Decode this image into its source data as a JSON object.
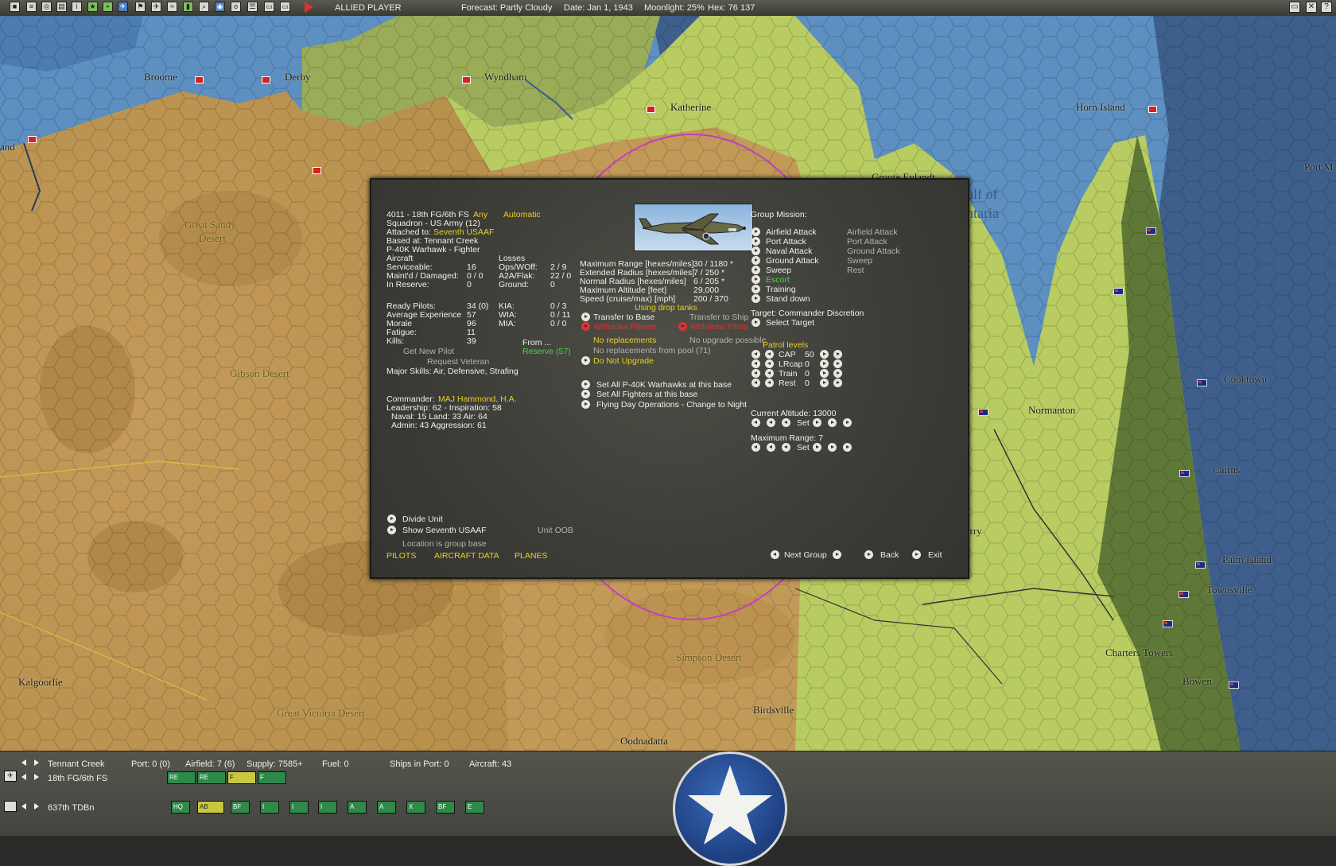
{
  "topbar": {
    "player": "ALLIED PLAYER",
    "forecast": "Forecast: Partly Cloudy",
    "date": "Date: Jan 1, 1943",
    "moonlight": "Moonlight: 25%",
    "hex": "Hex: 76 137",
    "toolbar_icons": [
      "save-icon",
      "report-icon",
      "intel-icon",
      "ships-icon",
      "info-icon",
      "star-icon",
      "bases-icon",
      "air-icon",
      "flag-icon",
      "planes-icon",
      "routes-icon",
      "units-icon",
      "search-icon",
      "globe-icon",
      "ob-icon",
      "list-icon",
      "screen-icon",
      "end-turn-icon"
    ]
  },
  "map": {
    "labels": {
      "broome": "Broome",
      "derby": "Derby",
      "wyndham": "Wyndham",
      "katherine": "Katherine",
      "horn_island": "Horn Island",
      "torres_strait": "Torres Strait",
      "port_m": "Port M",
      "groote": "Groote Eylandt",
      "gulf": "ulf of",
      "carpentaria": "ntaria",
      "great_sandy": "Great Sandy",
      "desert": "Desert",
      "gibson": "Gibson Desert",
      "normanton": "Normanton",
      "cooktown": "Cooktown",
      "cairns": "Cairns",
      "urry": "urry",
      "palm_island": "Palm Island",
      "townsville": "Townsville",
      "charters_towers": "Charters Towers",
      "bowen": "Bowen",
      "simpson": "Simpson Desert",
      "birdsville": "Birdsville",
      "great_victoria": "Great Victoria Desert",
      "kalgoorlie": "Kalgoorlie",
      "oodnadatta": "Oodnadatta",
      "land": "and"
    }
  },
  "dialog": {
    "unit_id": "4011 - 18th FG/6th FS",
    "any": "Any",
    "automatic": "Automatic",
    "squadron": "Squadron - US Army (12)",
    "attached_label": "Attached to:",
    "attached_value": "Seventh USAAF",
    "based_at": "Based at: Tennant Creek",
    "aircraft_type": "P-40K Warhawk - Fighter",
    "aircraft_header": "Aircraft",
    "losses_header": "Losses",
    "stats_left": [
      {
        "label": "Serviceable:",
        "value": "16"
      },
      {
        "label": "Maint'd / Damaged:",
        "value": "0 / 0"
      },
      {
        "label": "In Reserve:",
        "value": "0"
      }
    ],
    "stats_losses": [
      {
        "label": "Ops/WOff:",
        "value": "2 / 9"
      },
      {
        "label": "A2A/Flak:",
        "value": "22 / 0"
      },
      {
        "label": "Ground:",
        "value": "0"
      }
    ],
    "pilot_stats": [
      {
        "label": "Ready Pilots:",
        "value": "34 (0)"
      },
      {
        "label": "Average Experience",
        "value": "57"
      },
      {
        "label": "Morale",
        "value": "96"
      },
      {
        "label": "Fatigue:",
        "value": "11"
      },
      {
        "label": "Kills:",
        "value": "39"
      }
    ],
    "casualties": [
      {
        "label": "KIA:",
        "value": "0 / 3"
      },
      {
        "label": "WIA:",
        "value": "0 / 11"
      },
      {
        "label": "MIA:",
        "value": "0 / 0"
      }
    ],
    "get_new_pilot": "Get New Pilot",
    "request_veteran": "Request Veteran",
    "from": "From ...",
    "reserve": "Reserve (57)",
    "major_skills": "Major Skills: Air, Defensive, Strafing",
    "commander_label": "Commander:",
    "commander_value": "MAJ Hammond, H.A.",
    "leadership": "Leadership: 62 - Inspiration: 58",
    "naval_land_air": "Naval: 15  Land: 33  Air: 64",
    "admin_aggression": "Admin: 43  Aggression: 61",
    "performance": [
      {
        "label": "Maximum Range [hexes/miles]",
        "value": "30 / 1180 *"
      },
      {
        "label": "Extended Radius [hexes/miles]",
        "value": "7 / 250 *"
      },
      {
        "label": "Normal Radius [hexes/miles]",
        "value": "6 / 205 *"
      },
      {
        "label": "Maximum Altitude [feet]",
        "value": "29,000"
      },
      {
        "label": "Speed (cruise/max) [mph]",
        "value": "200 / 370"
      }
    ],
    "drop_tanks": "Using drop tanks",
    "transfer_base": "Transfer to Base",
    "transfer_ship": "Transfer to Ship",
    "withdraw_planes": "Withdraw Planes",
    "withdraw_pilots": "Withdraw Pilots",
    "no_replacements": "No replacements",
    "no_upgrade": "No upgrade possible",
    "no_repl_pool": "No replacements from pool (71)",
    "do_not_upgrade": "Do Not Upgrade",
    "set_all_p40": "Set All P-40K Warhawks at this base",
    "set_all_fighters": "Set All Fighters at this base",
    "flying_day": "Flying Day Operations - Change to Night",
    "group_mission": "Group Mission:",
    "missions": [
      {
        "label": "Airfield Attack",
        "secondary": "Airfield Attack",
        "active": false
      },
      {
        "label": "Port Attack",
        "secondary": "Port Attack",
        "active": false
      },
      {
        "label": "Naval Attack",
        "secondary": "Ground Attack",
        "active": false
      },
      {
        "label": "Ground Attack",
        "secondary": "Sweep",
        "active": false
      },
      {
        "label": "Sweep",
        "secondary": "Rest",
        "active": false
      },
      {
        "label": "Escort",
        "secondary": "",
        "active": true
      },
      {
        "label": "Training",
        "secondary": "",
        "active": false
      },
      {
        "label": "Stand down",
        "secondary": "",
        "active": false
      }
    ],
    "target": "Target: Commander Discretion",
    "select_target": "Select Target",
    "patrol_levels": "Patrol levels",
    "patrol": [
      {
        "label": "CAP",
        "value": "50"
      },
      {
        "label": "LRcap",
        "value": "0"
      },
      {
        "label": "Train",
        "value": "0"
      },
      {
        "label": "Rest",
        "value": "0"
      }
    ],
    "current_altitude": "Current Altitude: 13000",
    "set": "Set",
    "maximum_range": "Maximum Range: 7",
    "divide_unit": "Divide Unit",
    "show_seventh": "Show Seventh USAAF",
    "unit_oob": "Unit OOB",
    "location_group": "Location is group base",
    "tab_pilots": "PILOTS",
    "tab_aircraft": "AIRCRAFT DATA",
    "tab_planes": "PLANES",
    "next_group": "Next Group",
    "back": "Back",
    "exit": "Exit"
  },
  "bottombar": {
    "base_name": "Tennant Creek",
    "port": "Port: 0 (0)",
    "airfield": "Airfield: 7 (6)",
    "supply": "Supply: 7585+",
    "fuel": "Fuel: 0",
    "ships_in_port": "Ships in Port: 0",
    "aircraft": "Aircraft: 43",
    "air_unit": "18th FG/6th FS",
    "ground_unit": "637th TDBn",
    "air_chips": [
      "RE",
      "RE",
      "F",
      "F"
    ],
    "ground_chips": [
      "HQ",
      "AB",
      "BF",
      "I",
      "I",
      "I",
      "A",
      "A",
      "X",
      "BF",
      "E"
    ]
  }
}
